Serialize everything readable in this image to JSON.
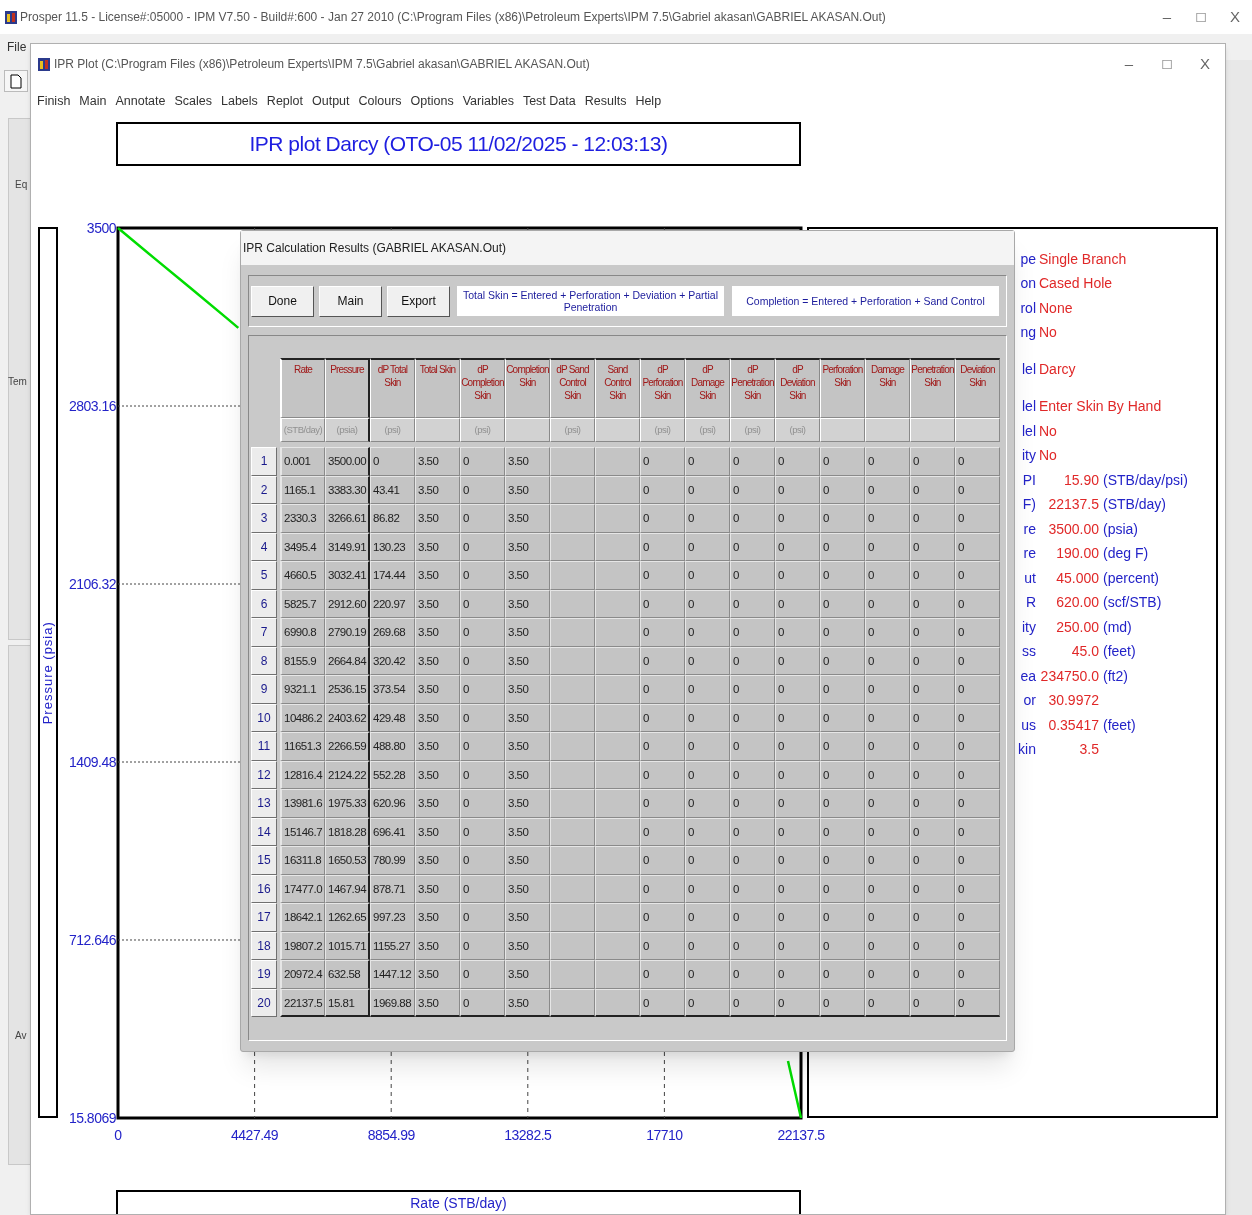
{
  "main_window": {
    "title": "Prosper 11.5 - License#:05000 - IPM V7.50 - Build#:600 - Jan 27 2010 (C:\\Program Files (x86)\\Petroleum Experts\\IPM 7.5\\Gabriel akasan\\GABRIEL AKASAN.Out)",
    "controls": [
      "–",
      "□",
      "X"
    ],
    "menu": [
      "File"
    ],
    "side_labels": [
      "Eq",
      "Tem",
      "Av"
    ]
  },
  "plot_window": {
    "title": "IPR Plot (C:\\Program Files (x86)\\Petroleum Experts\\IPM 7.5\\Gabriel akasan\\GABRIEL AKASAN.Out)",
    "controls": [
      "–",
      "□",
      "X"
    ],
    "menu": [
      "Finish",
      "Main",
      "Annotate",
      "Scales",
      "Labels",
      "Replot",
      "Output",
      "Colours",
      "Options",
      "Variables",
      "Test Data",
      "Results",
      "Help"
    ],
    "plot": {
      "chart_data": {
        "type": "line",
        "title": "IPR plot Darcy (OTO-05 11/02/2025 - 12:03:13)",
        "xlabel": "Rate (STB/day)",
        "ylabel": "Pressure (psia)",
        "xlim": [
          0,
          22137.5
        ],
        "ylim": [
          15.8069,
          3500
        ],
        "xticks": [
          0,
          4427.49,
          8854.99,
          13282.5,
          17710,
          22137.5
        ],
        "yticks": [
          15.8069,
          712.646,
          1409.48,
          2106.32,
          2803.16,
          3500
        ],
        "x": [
          0.001,
          1165.1,
          2330.3,
          3495.4,
          3900,
          20972.4,
          21716,
          22137.5
        ],
        "grid": true,
        "series": [
          {
            "color": "#00dd00",
            "values": [
              3500,
              3383,
              3267,
              3150,
              3109,
              null,
              239,
              16
            ]
          }
        ]
      }
    },
    "info_panel": {
      "sections": [
        [
          {
            "kind": "text",
            "label": "pe",
            "value": "Single Branch"
          },
          {
            "kind": "text",
            "label": "on",
            "value": "Cased Hole"
          },
          {
            "kind": "text",
            "label": "rol",
            "value": "None"
          },
          {
            "kind": "text",
            "label": "ng",
            "value": "No"
          }
        ],
        [
          {
            "kind": "text",
            "label": "lel",
            "value": "Darcy"
          }
        ],
        [
          {
            "kind": "text",
            "label": "lel",
            "value": "Enter Skin By Hand"
          },
          {
            "kind": "text",
            "label": "lel",
            "value": "No"
          },
          {
            "kind": "text",
            "label": "ity",
            "value": "No"
          },
          {
            "kind": "number",
            "label": "PI",
            "value": "15.90",
            "unit": "(STB/day/psi)"
          },
          {
            "kind": "number",
            "label": "F)",
            "value": "22137.5",
            "unit": "(STB/day)"
          },
          {
            "kind": "number",
            "label": "re",
            "value": "3500.00",
            "unit": "(psia)"
          },
          {
            "kind": "number",
            "label": "re",
            "value": "190.00",
            "unit": "(deg F)"
          },
          {
            "kind": "number",
            "label": "ut",
            "value": "45.000",
            "unit": "(percent)"
          },
          {
            "kind": "number",
            "label": "R",
            "value": "620.00",
            "unit": "(scf/STB)"
          },
          {
            "kind": "number",
            "label": "ity",
            "value": "250.00",
            "unit": "(md)"
          },
          {
            "kind": "number",
            "label": "ss",
            "value": "45.0",
            "unit": "(feet)"
          },
          {
            "kind": "number",
            "label": "ea",
            "value": "234750.0",
            "unit": "(ft2)"
          },
          {
            "kind": "number",
            "label": "or",
            "value": "30.9972"
          },
          {
            "kind": "number",
            "label": "us",
            "value": "0.35417",
            "unit": "(feet)"
          },
          {
            "kind": "number",
            "label": "kin",
            "value": "3.5"
          }
        ]
      ]
    }
  },
  "results_dialog": {
    "title": "IPR Calculation Results (GABRIEL AKASAN.Out)",
    "buttons": [
      "Done",
      "Main",
      "Export"
    ],
    "notes": [
      "Total Skin = Entered + Perforation + Deviation + Partial Penetration",
      "Completion = Entered + Perforation + Sand Control"
    ],
    "table": {
      "columns": [
        {
          "label": "Rate",
          "unit": "(STB/day)"
        },
        {
          "label": "Pressure",
          "unit": "(psia)"
        },
        {
          "label": "dP Total Skin",
          "unit": "(psi)"
        },
        {
          "label": "Total Skin"
        },
        {
          "label": "dP Completion Skin",
          "unit": "(psi)"
        },
        {
          "label": "Completion Skin"
        },
        {
          "label": "dP Sand Control Skin",
          "unit": "(psi)"
        },
        {
          "label": "Sand Control Skin"
        },
        {
          "label": "dP Perforation Skin",
          "unit": "(psi)"
        },
        {
          "label": "dP Damage Skin",
          "unit": "(psi)"
        },
        {
          "label": "dP Penetration Skin",
          "unit": "(psi)"
        },
        {
          "label": "dP Deviation Skin",
          "unit": "(psi)"
        },
        {
          "label": "Perforation Skin"
        },
        {
          "label": "Damage Skin"
        },
        {
          "label": "Penetration Skin"
        },
        {
          "label": "Deviation Skin"
        }
      ],
      "rows": [
        {
          "number": "1",
          "cells": [
            "0.001",
            "3500.00",
            "0",
            "3.50",
            "0",
            "3.50",
            null,
            null,
            "0",
            "0",
            "0",
            "0",
            "0",
            "0",
            "0",
            "0"
          ]
        },
        {
          "number": "2",
          "cells": [
            "1165.1",
            "3383.30",
            "43.41",
            "3.50",
            "0",
            "3.50",
            null,
            null,
            "0",
            "0",
            "0",
            "0",
            "0",
            "0",
            "0",
            "0"
          ]
        },
        {
          "number": "3",
          "cells": [
            "2330.3",
            "3266.61",
            "86.82",
            "3.50",
            "0",
            "3.50",
            null,
            null,
            "0",
            "0",
            "0",
            "0",
            "0",
            "0",
            "0",
            "0"
          ]
        },
        {
          "number": "4",
          "cells": [
            "3495.4",
            "3149.91",
            "130.23",
            "3.50",
            "0",
            "3.50",
            null,
            null,
            "0",
            "0",
            "0",
            "0",
            "0",
            "0",
            "0",
            "0"
          ]
        },
        {
          "number": "5",
          "cells": [
            "4660.5",
            "3032.41",
            "174.44",
            "3.50",
            "0",
            "3.50",
            null,
            null,
            "0",
            "0",
            "0",
            "0",
            "0",
            "0",
            "0",
            "0"
          ]
        },
        {
          "number": "6",
          "cells": [
            "5825.7",
            "2912.60",
            "220.97",
            "3.50",
            "0",
            "3.50",
            null,
            null,
            "0",
            "0",
            "0",
            "0",
            "0",
            "0",
            "0",
            "0"
          ]
        },
        {
          "number": "7",
          "cells": [
            "6990.8",
            "2790.19",
            "269.68",
            "3.50",
            "0",
            "3.50",
            null,
            null,
            "0",
            "0",
            "0",
            "0",
            "0",
            "0",
            "0",
            "0"
          ]
        },
        {
          "number": "8",
          "cells": [
            "8155.9",
            "2664.84",
            "320.42",
            "3.50",
            "0",
            "3.50",
            null,
            null,
            "0",
            "0",
            "0",
            "0",
            "0",
            "0",
            "0",
            "0"
          ]
        },
        {
          "number": "9",
          "cells": [
            "9321.1",
            "2536.15",
            "373.54",
            "3.50",
            "0",
            "3.50",
            null,
            null,
            "0",
            "0",
            "0",
            "0",
            "0",
            "0",
            "0",
            "0"
          ]
        },
        {
          "number": "10",
          "cells": [
            "10486.2",
            "2403.62",
            "429.48",
            "3.50",
            "0",
            "3.50",
            null,
            null,
            "0",
            "0",
            "0",
            "0",
            "0",
            "0",
            "0",
            "0"
          ]
        },
        {
          "number": "11",
          "cells": [
            "11651.3",
            "2266.59",
            "488.80",
            "3.50",
            "0",
            "3.50",
            null,
            null,
            "0",
            "0",
            "0",
            "0",
            "0",
            "0",
            "0",
            "0"
          ]
        },
        {
          "number": "12",
          "cells": [
            "12816.4",
            "2124.22",
            "552.28",
            "3.50",
            "0",
            "3.50",
            null,
            null,
            "0",
            "0",
            "0",
            "0",
            "0",
            "0",
            "0",
            "0"
          ]
        },
        {
          "number": "13",
          "cells": [
            "13981.6",
            "1975.33",
            "620.96",
            "3.50",
            "0",
            "3.50",
            null,
            null,
            "0",
            "0",
            "0",
            "0",
            "0",
            "0",
            "0",
            "0"
          ]
        },
        {
          "number": "14",
          "cells": [
            "15146.7",
            "1818.28",
            "696.41",
            "3.50",
            "0",
            "3.50",
            null,
            null,
            "0",
            "0",
            "0",
            "0",
            "0",
            "0",
            "0",
            "0"
          ]
        },
        {
          "number": "15",
          "cells": [
            "16311.8",
            "1650.53",
            "780.99",
            "3.50",
            "0",
            "3.50",
            null,
            null,
            "0",
            "0",
            "0",
            "0",
            "0",
            "0",
            "0",
            "0"
          ]
        },
        {
          "number": "16",
          "cells": [
            "17477.0",
            "1467.94",
            "878.71",
            "3.50",
            "0",
            "3.50",
            null,
            null,
            "0",
            "0",
            "0",
            "0",
            "0",
            "0",
            "0",
            "0"
          ]
        },
        {
          "number": "17",
          "cells": [
            "18642.1",
            "1262.65",
            "997.23",
            "3.50",
            "0",
            "3.50",
            null,
            null,
            "0",
            "0",
            "0",
            "0",
            "0",
            "0",
            "0",
            "0"
          ]
        },
        {
          "number": "18",
          "cells": [
            "19807.2",
            "1015.71",
            "1155.27",
            "3.50",
            "0",
            "3.50",
            null,
            null,
            "0",
            "0",
            "0",
            "0",
            "0",
            "0",
            "0",
            "0"
          ]
        },
        {
          "number": "19",
          "cells": [
            "20972.4",
            "632.58",
            "1447.12",
            "3.50",
            "0",
            "3.50",
            null,
            null,
            "0",
            "0",
            "0",
            "0",
            "0",
            "0",
            "0",
            "0"
          ]
        },
        {
          "number": "20",
          "cells": [
            "22137.5",
            "15.81",
            "1969.88",
            "3.50",
            "0",
            "3.50",
            null,
            null,
            "0",
            "0",
            "0",
            "0",
            "0",
            "0",
            "0",
            "0"
          ]
        }
      ]
    }
  }
}
